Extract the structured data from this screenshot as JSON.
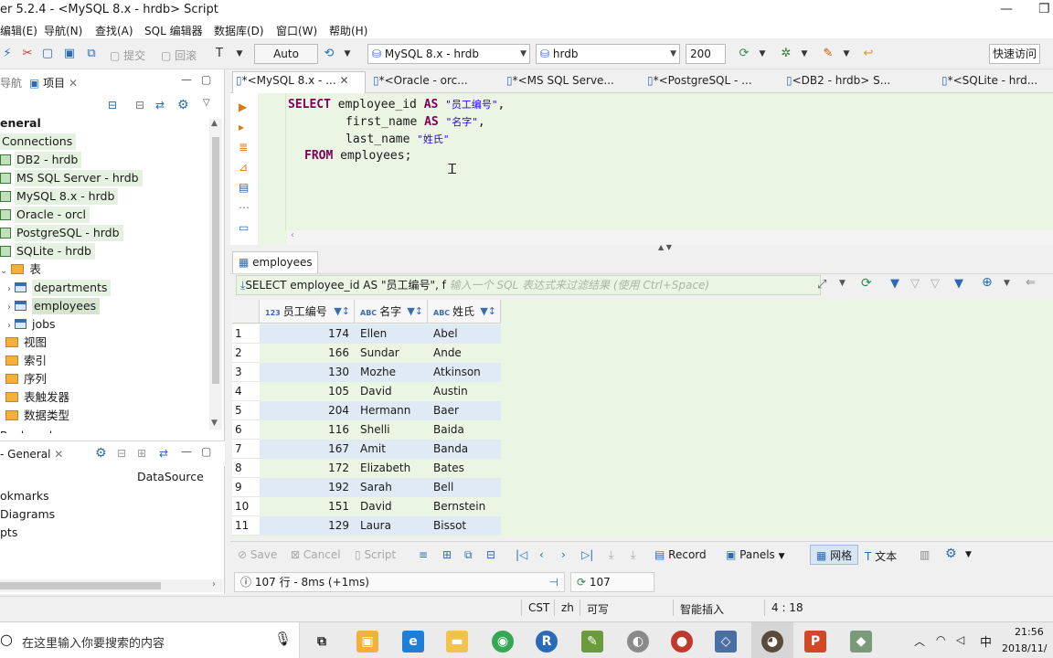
{
  "window": {
    "title": "er 5.2.4 - <MySQL 8.x - hrdb> Script",
    "min_glyph": "—",
    "max_glyph": "❐"
  },
  "menu": [
    "编辑(E)",
    "导航(N)",
    "查找(A)",
    "SQL 编辑器",
    "数据库(D)",
    "窗口(W)",
    "帮助(H)"
  ],
  "toolbar": {
    "commit_label": "提交",
    "rollback_label": "回滚",
    "auto_label": "Auto",
    "connection": "MySQL 8.x - hrdb",
    "database": "hrdb",
    "limit": "200",
    "quick_access": "快速访问"
  },
  "left_panel": {
    "tab_nav": "导航",
    "tab_project": "项目",
    "tree": {
      "general": "eneral",
      "connections": "Connections",
      "conn": [
        "DB2 - hrdb",
        "MS SQL Server - hrdb",
        "MySQL 8.x - hrdb",
        "Oracle - orcl",
        "PostgreSQL - hrdb",
        "SQLite - hrdb"
      ],
      "tables_folder": "表",
      "tables": [
        "departments",
        "employees",
        "jobs"
      ],
      "folders": [
        "视图",
        "索引",
        "序列",
        "表触发器",
        "数据类型"
      ],
      "cut_item": "Bookmarks"
    },
    "bottom_tab": "- General",
    "datasource_header": "DataSource",
    "bottom_items": [
      "okmarks",
      "Diagrams",
      "pts"
    ]
  },
  "editor": {
    "tabs": [
      "*<MySQL 8.x - ...",
      "*<Oracle - orc...",
      "*<MS SQL Serve...",
      "*<PostgreSQL - ...",
      "<DB2 - hrdb> S...",
      "*<SQLite - hrd..."
    ],
    "sql": {
      "l1_kw": "SELECT",
      "l1_col": " employee_id ",
      "l1_as": "AS",
      "l1_alias": "\"员工编号\"",
      "l1_end": ",",
      "l2_col": "first_name ",
      "l2_as": "AS",
      "l2_alias": "\"名字\"",
      "l2_end": ",",
      "l3_col": "last_name ",
      "l3_alias": "\"姓氏\"",
      "l4_kw": "FROM",
      "l4_rest": " employees;"
    }
  },
  "results": {
    "tab_label": "employees",
    "filter_sql": "SELECT employee_id AS \"员工编号\", f",
    "filter_placeholder": "输入一个 SQL 表达式来过滤结果 (使用 Ctrl+Space)",
    "columns": [
      {
        "type": "123",
        "name": "员工编号"
      },
      {
        "type": "ABC",
        "name": "名字"
      },
      {
        "type": "ABC",
        "name": "姓氏"
      }
    ],
    "rows": [
      [
        "1",
        "174",
        "Ellen",
        "Abel"
      ],
      [
        "2",
        "166",
        "Sundar",
        "Ande"
      ],
      [
        "3",
        "130",
        "Mozhe",
        "Atkinson"
      ],
      [
        "4",
        "105",
        "David",
        "Austin"
      ],
      [
        "5",
        "204",
        "Hermann",
        "Baer"
      ],
      [
        "6",
        "116",
        "Shelli",
        "Baida"
      ],
      [
        "7",
        "167",
        "Amit",
        "Banda"
      ],
      [
        "8",
        "172",
        "Elizabeth",
        "Bates"
      ],
      [
        "9",
        "192",
        "Sarah",
        "Bell"
      ],
      [
        "10",
        "151",
        "David",
        "Bernstein"
      ],
      [
        "11",
        "129",
        "Laura",
        "Bissot"
      ]
    ],
    "toolbar": {
      "save": "Save",
      "cancel": "Cancel",
      "script": "Script",
      "record": "Record",
      "panels": "Panels",
      "grid": "网格",
      "text": "文本"
    },
    "status_text": "107 行 - 8ms (+1ms)",
    "fetch_count": "107"
  },
  "app_status": {
    "tz": "CST",
    "locale": "zh",
    "writable": "可写",
    "insert_mode": "智能插入",
    "position": "4 : 18"
  },
  "taskbar": {
    "search_placeholder": "在这里输入你要搜索的内容",
    "time": "21:56",
    "date": "2018/11/",
    "ime": "中"
  },
  "colors": {
    "editor_bg": "#eaf5e4",
    "keyword": "#7f0055",
    "string": "#2a00ff",
    "accent": "#2a6bb8"
  }
}
